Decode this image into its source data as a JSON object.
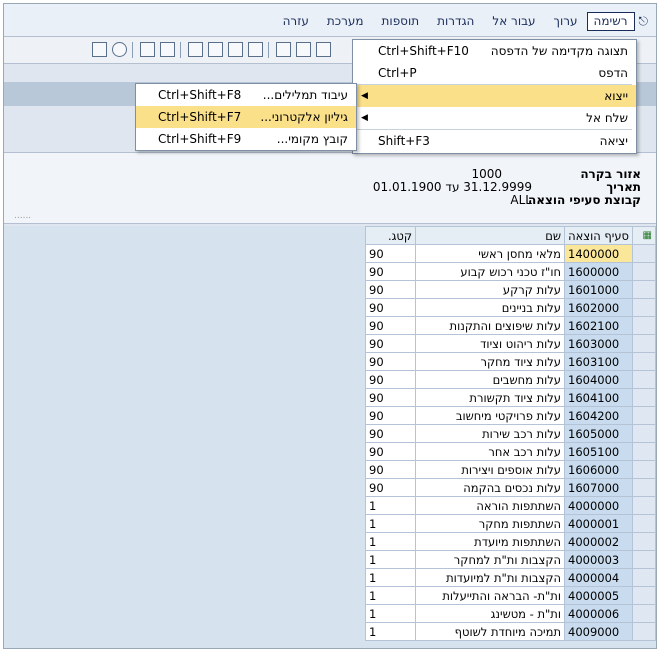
{
  "menubar": {
    "items": [
      {
        "label": "רשימה"
      },
      {
        "label": "ערוך"
      },
      {
        "label": "עבור אל"
      },
      {
        "label": "הגדרות"
      },
      {
        "label": "תוספות"
      },
      {
        "label": "מערכת"
      },
      {
        "label": "עזרה"
      }
    ]
  },
  "list_menu": {
    "items": [
      {
        "label": "תצוגה מקדימה של הדפסה",
        "shortcut": "Ctrl+Shift+F10"
      },
      {
        "label": "הדפס",
        "shortcut": "Ctrl+P"
      },
      {
        "label": "ייצוא",
        "shortcut": ""
      },
      {
        "label": "שלח אל",
        "shortcut": ""
      },
      {
        "label": "יציאה",
        "shortcut": "Shift+F3"
      }
    ]
  },
  "export_submenu": {
    "items": [
      {
        "label": "עיבוד תמלילים...",
        "shortcut": "Ctrl+Shift+F8"
      },
      {
        "label": "גיליון אלקטרוני...",
        "shortcut": "Ctrl+Shift+F7"
      },
      {
        "label": "קובץ מקומי...",
        "shortcut": "Ctrl+Shift+F9"
      }
    ]
  },
  "header": {
    "area_label": "אזור בקרה",
    "area_value": "1000",
    "date_label": "תאריך",
    "date_value": "31.12.9999 עד 01.01.1900",
    "group_label": "קבוצת סעיפי הוצאה",
    "group_value": "ALL"
  },
  "grid": {
    "columns": {
      "account": "סעיף הוצאה",
      "name": "שם",
      "category": "קטג."
    },
    "rows": [
      {
        "account": "1400000",
        "name": "מלאי מחסן ראשי",
        "category": "90"
      },
      {
        "account": "1600000",
        "name": "חו\"ז טכני רכוש קבוע",
        "category": "90"
      },
      {
        "account": "1601000",
        "name": "עלות קרקע",
        "category": "90"
      },
      {
        "account": "1602000",
        "name": "עלות בניינים",
        "category": "90"
      },
      {
        "account": "1602100",
        "name": "עלות שיפוצים והתקנות",
        "category": "90"
      },
      {
        "account": "1603000",
        "name": "עלות ריהוט וציוד",
        "category": "90"
      },
      {
        "account": "1603100",
        "name": "עלות ציוד מחקר",
        "category": "90"
      },
      {
        "account": "1604000",
        "name": "עלות מחשבים",
        "category": "90"
      },
      {
        "account": "1604100",
        "name": "עלות ציוד תקשורת",
        "category": "90"
      },
      {
        "account": "1604200",
        "name": "עלות פרויקטי מיחשוב",
        "category": "90"
      },
      {
        "account": "1605000",
        "name": "עלות רכב שירות",
        "category": "90"
      },
      {
        "account": "1605100",
        "name": "עלות רכב אחר",
        "category": "90"
      },
      {
        "account": "1606000",
        "name": "עלות אוספים ויצירות",
        "category": "90"
      },
      {
        "account": "1607000",
        "name": "עלות נכסים בהקמה",
        "category": "90"
      },
      {
        "account": "4000000",
        "name": "השתתפות הוראה",
        "category": "1"
      },
      {
        "account": "4000001",
        "name": "השתתפות מחקר",
        "category": "1"
      },
      {
        "account": "4000002",
        "name": "השתתפות מיועדת",
        "category": "1"
      },
      {
        "account": "4000003",
        "name": "הקצבות ות\"ת למחקר",
        "category": "1"
      },
      {
        "account": "4000004",
        "name": "הקצבות ות\"ת למיועדות",
        "category": "1"
      },
      {
        "account": "4000005",
        "name": "ות\"ת- הבראה והתייעלות",
        "category": "1"
      },
      {
        "account": "4000006",
        "name": "ות\"ת - מטשינג",
        "category": "1"
      },
      {
        "account": "4009000",
        "name": "תמיכה מיוחדת לשוטף",
        "category": "1"
      }
    ]
  }
}
